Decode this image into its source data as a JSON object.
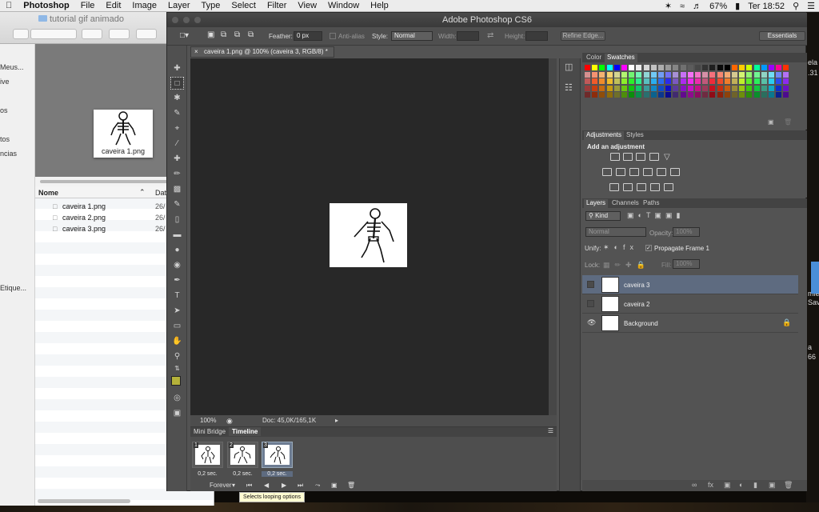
{
  "menubar": {
    "app": "Photoshop",
    "items": [
      "File",
      "Edit",
      "Image",
      "Layer",
      "Type",
      "Select",
      "Filter",
      "View",
      "Window",
      "Help"
    ],
    "battery": "67%",
    "clock": "Ter 18:52"
  },
  "finder": {
    "title": "tutorial gif animado",
    "sidebar_items": [
      "Meus...",
      "ive",
      "os",
      "tos",
      "ncias",
      "Etique..."
    ],
    "preview_label": "caveira 1.png",
    "columns": {
      "name": "Nome",
      "date": "Dat"
    },
    "files": [
      {
        "name": "caveira 1.png",
        "date": "26/"
      },
      {
        "name": "caveira 2.png",
        "date": "26/"
      },
      {
        "name": "caveira 3.png",
        "date": "26/"
      }
    ]
  },
  "desktop": {
    "labels": [
      "ela",
      ".31",
      "mier",
      "Save",
      "a",
      "66"
    ]
  },
  "photoshop": {
    "window_title": "Adobe Photoshop CS6",
    "options": {
      "feather_label": "Feather:",
      "feather_value": "0 px",
      "antialias_label": "Anti-alias",
      "style_label": "Style:",
      "style_value": "Normal",
      "width_label": "Width:",
      "height_label": "Height:",
      "refine_edge": "Refine Edge...",
      "workspace": "Essentials"
    },
    "document_tab": "caveira 1.png @ 100% (caveira 3, RGB/8) *",
    "status": {
      "zoom": "100%",
      "doc": "Doc: 45,0K/165,1K"
    },
    "timeline": {
      "tabs": [
        "Mini Bridge",
        "Timeline"
      ],
      "frames": [
        {
          "number": "1",
          "duration": "0,2 sec."
        },
        {
          "number": "2",
          "duration": "0,2 sec."
        },
        {
          "number": "3",
          "duration": "0,2 sec."
        }
      ],
      "loop": "Forever",
      "tooltip": "Selects looping options"
    },
    "swatches_panel": {
      "tabs": [
        "Color",
        "Swatches"
      ]
    },
    "adjustments_panel": {
      "tabs": [
        "Adjustments",
        "Styles"
      ],
      "heading": "Add an adjustment"
    },
    "layers_panel": {
      "tabs": [
        "Layers",
        "Channels",
        "Paths"
      ],
      "filter": "Kind",
      "blend_mode": "Normal",
      "opacity_label": "Opacity:",
      "opacity_value": "100%",
      "unify_label": "Unify:",
      "propagate_label": "Propagate Frame 1",
      "lock_label": "Lock:",
      "fill_label": "Fill:",
      "fill_value": "100%",
      "layers": [
        {
          "name": "caveira 3",
          "selected": true,
          "visible": false
        },
        {
          "name": "caveira 2",
          "selected": false,
          "visible": false
        },
        {
          "name": "Background",
          "selected": false,
          "visible": true,
          "locked": true
        }
      ]
    },
    "foreground_color": "#b5b23a",
    "background_color": "#ffffff"
  }
}
